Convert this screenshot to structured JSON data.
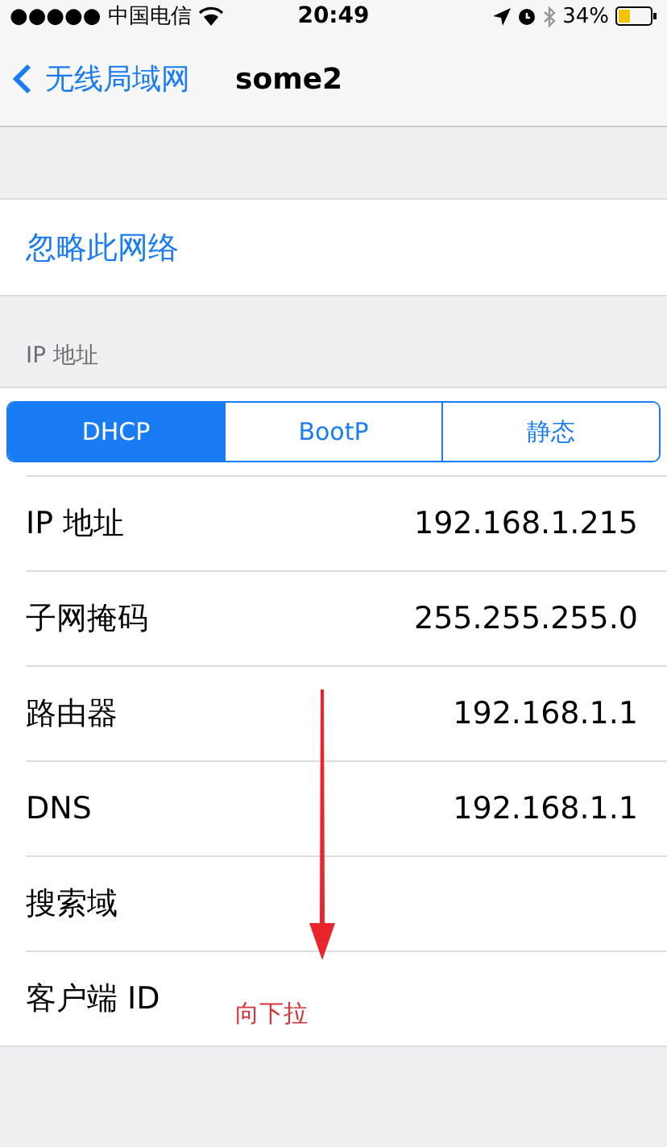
{
  "status_bar": {
    "carrier": "●●●●● 中国电信",
    "time": "20:49",
    "battery": "34%"
  },
  "nav": {
    "back": "无线局域网",
    "title": "some2"
  },
  "forget": "忽略此网络",
  "section_header": "IP 地址",
  "segments": [
    {
      "label": "DHCP",
      "selected": true
    },
    {
      "label": "BootP",
      "selected": false
    },
    {
      "label": "静态",
      "selected": false
    }
  ],
  "rows": [
    {
      "label": "IP 地址",
      "value": "192.168.1.215"
    },
    {
      "label": "子网掩码",
      "value": "255.255.255.0"
    },
    {
      "label": "路由器",
      "value": "192.168.1.1"
    },
    {
      "label": "DNS",
      "value": "192.168.1.1"
    },
    {
      "label": "搜索域"
    },
    {
      "label": "客户端 ID"
    }
  ],
  "annotation": "向下拉"
}
